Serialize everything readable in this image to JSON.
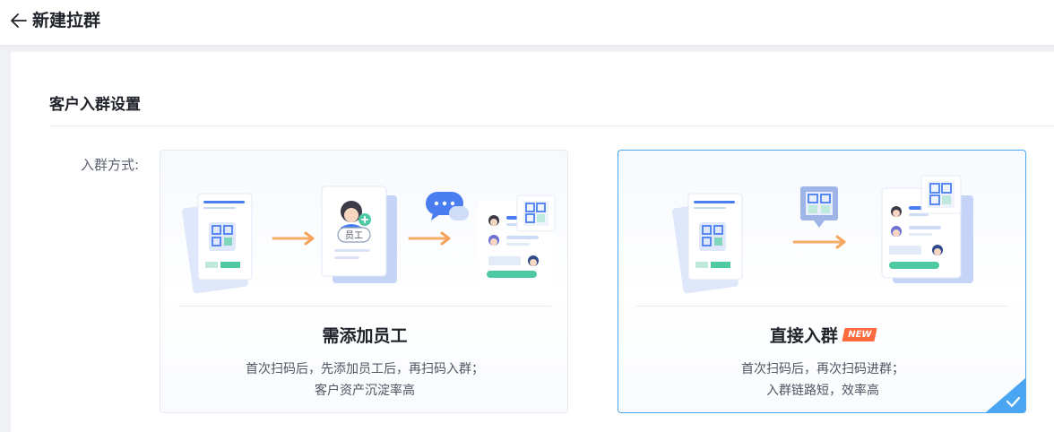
{
  "header": {
    "title": "新建拉群"
  },
  "section": {
    "title": "客户入群设置"
  },
  "form": {
    "label": "入群方式:"
  },
  "options": [
    {
      "title": "需添加员工",
      "desc": [
        "首次扫码后，先添加员工后，再扫码入群；",
        "客户资产沉淀率高"
      ],
      "staff_tag": "员工",
      "selected": false
    },
    {
      "title": "直接入群",
      "badge": "NEW",
      "desc": [
        "首次扫码后，再次扫码进群；",
        "入群链路短，效率高"
      ],
      "selected": true
    }
  ],
  "colors": {
    "accent": "#4aa6f2",
    "primary_blue": "#4a7ef0",
    "arrow_orange": "#f6a45c",
    "green": "#4fc8a4",
    "badge_red": "#ff6b3d"
  }
}
